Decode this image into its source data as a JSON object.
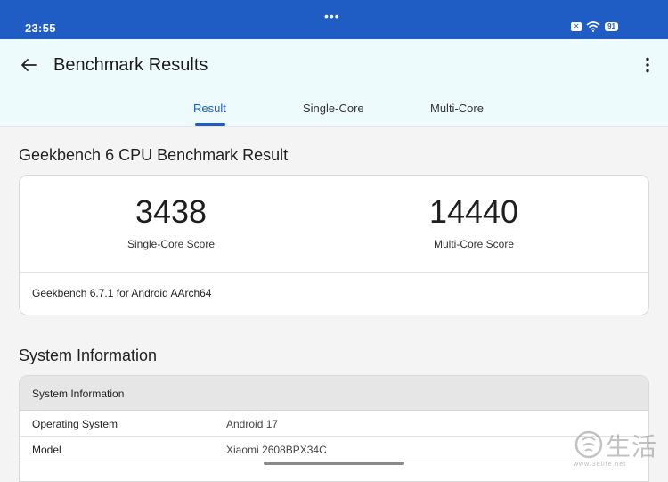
{
  "status_bar": {
    "time": "23:55",
    "battery": "91",
    "icons": [
      "sim-off-icon",
      "wifi-icon",
      "battery-icon"
    ]
  },
  "header": {
    "title": "Benchmark Results",
    "back_icon": "arrow-left-icon",
    "more_icon": "more-vert-icon"
  },
  "tabs": [
    {
      "label": "Result",
      "active": true
    },
    {
      "label": "Single-Core",
      "active": false
    },
    {
      "label": "Multi-Core",
      "active": false
    }
  ],
  "result": {
    "section_title": "Geekbench 6 CPU Benchmark Result",
    "single_core": {
      "score": "3438",
      "label": "Single-Core Score"
    },
    "multi_core": {
      "score": "14440",
      "label": "Multi-Core Score"
    },
    "version": "Geekbench 6.7.1 for Android AArch64"
  },
  "system": {
    "section_title": "System Information",
    "table_header": "System Information",
    "rows": [
      {
        "key": "Operating System",
        "value": "Android 17"
      },
      {
        "key": "Model",
        "value": "Xiaomi 2608BPX34C"
      }
    ]
  },
  "watermark": {
    "text": "生活",
    "url": "www.3elife.net"
  },
  "colors": {
    "accent": "#1f5cc4",
    "header_bg": "#eefbfd",
    "page_bg": "#f4f4f4"
  }
}
